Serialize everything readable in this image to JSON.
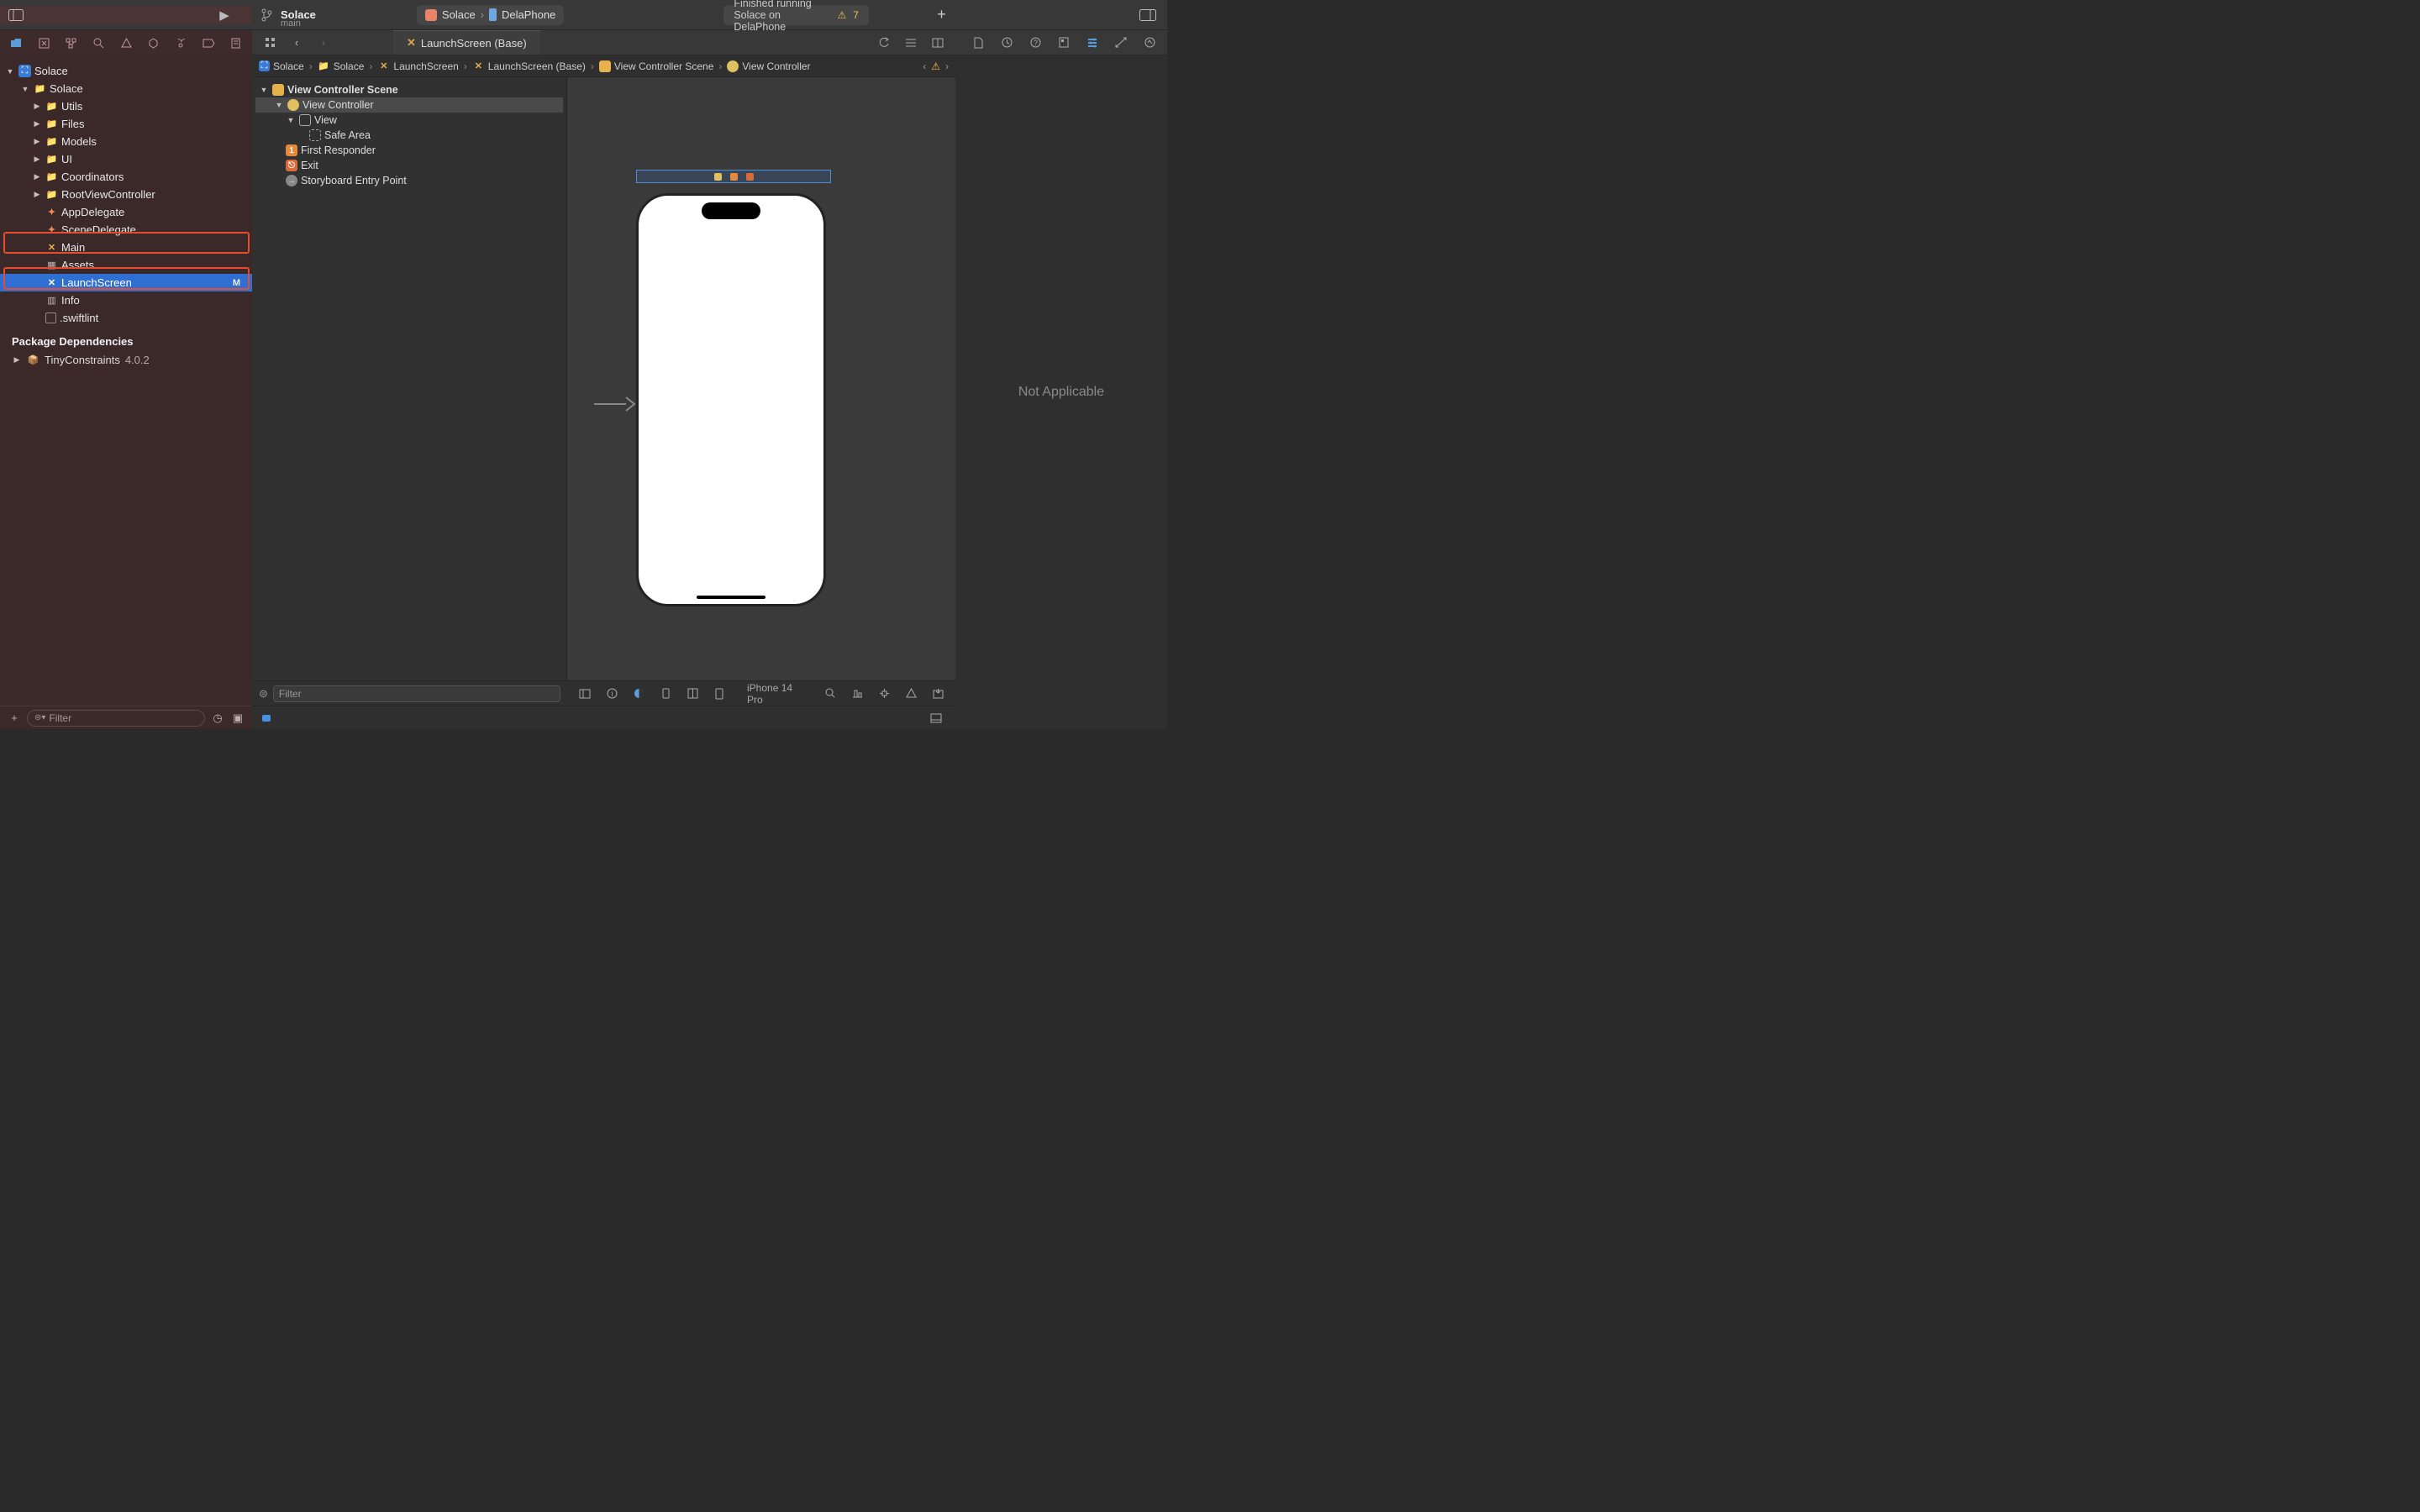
{
  "titlebar": {
    "project": "Solace",
    "branch": "main",
    "scheme": "Solace",
    "device": "DelaPhone",
    "status": "Finished running Solace on DelaPhone",
    "warnings": "7"
  },
  "tab": {
    "label": "LaunchScreen (Base)"
  },
  "navigator": {
    "root": "Solace",
    "folder": "Solace",
    "groups": [
      "Utils",
      "Files",
      "Models",
      "UI",
      "Coordinators",
      "RootViewController"
    ],
    "files": {
      "appdelegate": "AppDelegate",
      "scenedelegate": "SceneDelegate",
      "main": "Main",
      "assets": "Assets",
      "launchscreen": "LaunchScreen",
      "launchscreen_status": "M",
      "info": "Info",
      "swiftlint": ".swiftlint"
    },
    "pkg_header": "Package Dependencies",
    "pkg_name": "TinyConstraints",
    "pkg_version": "4.0.2",
    "filter_placeholder": "Filter"
  },
  "breadcrumb": {
    "items": [
      "Solace",
      "Solace",
      "LaunchScreen",
      "LaunchScreen (Base)",
      "View Controller Scene",
      "View Controller"
    ]
  },
  "outline": {
    "scene": "View Controller Scene",
    "vc": "View Controller",
    "view": "View",
    "safearea": "Safe Area",
    "first": "First Responder",
    "exit": "Exit",
    "entry": "Storyboard Entry Point",
    "filter_placeholder": "Filter"
  },
  "canvas": {
    "device": "iPhone 14 Pro"
  },
  "inspector": {
    "placeholder": "Not Applicable"
  },
  "icons": {
    "folder": "📁",
    "play": "▶",
    "warn": "⚠"
  },
  "colors": {
    "accent": "#2f6fd1",
    "highlight": "#e84b2e"
  }
}
